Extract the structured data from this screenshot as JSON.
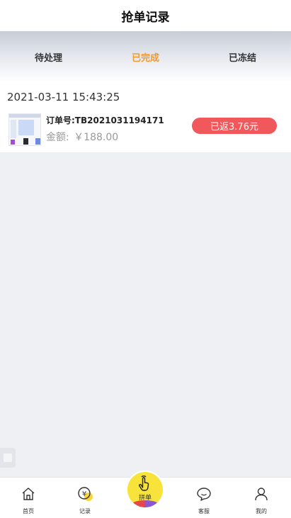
{
  "header": {
    "title": "抢单记录"
  },
  "tabs": [
    {
      "label": "待处理",
      "active": false
    },
    {
      "label": "已完成",
      "active": true
    },
    {
      "label": "已冻结",
      "active": false
    }
  ],
  "record": {
    "date": "2021-03-11 15:43:25",
    "order_no": "订单号:TB2021031194171",
    "amount_label": "金额:",
    "amount_value": "￥188.00",
    "status": "已返3.76元"
  },
  "nav": {
    "items": [
      {
        "label": "首页",
        "icon": "home-icon"
      },
      {
        "label": "记录",
        "icon": "yen-coin-icon"
      },
      {
        "label": "客服",
        "icon": "chat-bubble-icon"
      },
      {
        "label": "我的",
        "icon": "person-icon"
      }
    ],
    "center": {
      "label": "拼单",
      "icon": "tap-hand-icon"
    }
  },
  "colors": {
    "accent": "#f29a2e",
    "badge": "#f0585c",
    "center_button": "#f7e33a",
    "record_icon_badge": "#f6d63a"
  }
}
